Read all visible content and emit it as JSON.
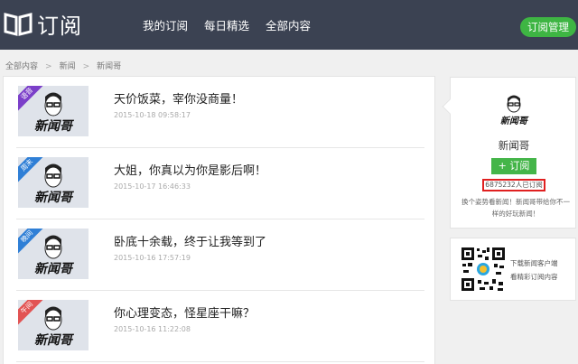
{
  "header": {
    "logo_text": "订阅",
    "nav": [
      "我的订阅",
      "每日精选",
      "全部内容"
    ],
    "manage_button": "订阅管理"
  },
  "breadcrumb": [
    "全部内容",
    "新闻",
    "新闻哥"
  ],
  "articles": [
    {
      "title": "天价饭菜，宰你没商量！",
      "date": "2015-10-18 09:58:17",
      "badge": "语音",
      "badge_color": "#7b3fc9"
    },
    {
      "title": "大姐，你真以为你是影后啊！",
      "date": "2015-10-17 16:46:33",
      "badge": "周末",
      "badge_color": "#2f7fd6"
    },
    {
      "title": "卧底十余载，终于让我等到了",
      "date": "2015-10-16 17:57:19",
      "badge": "晚间",
      "badge_color": "#2f7fd6"
    },
    {
      "title": "你心理变态，怪星座干嘛？",
      "date": "2015-10-16 11:22:08",
      "badge": "午间",
      "badge_color": "#e25353"
    }
  ],
  "thumbnail_logo_text": "新闻哥",
  "profile": {
    "avatar_logo_text": "新闻哥",
    "name": "新闻哥",
    "follow_label": "+ 订阅",
    "subscriber_count": "6875232人已订阅",
    "description": "换个姿势看新闻！新闻哥带给你不一样的好玩新闻！"
  },
  "qr_card": {
    "line1": "下载新闻客户端",
    "line2": "看精彩订阅内容"
  },
  "colors": {
    "topbar": "#3b4252",
    "accent_green": "#3eb543",
    "highlight_red": "#e02020"
  }
}
